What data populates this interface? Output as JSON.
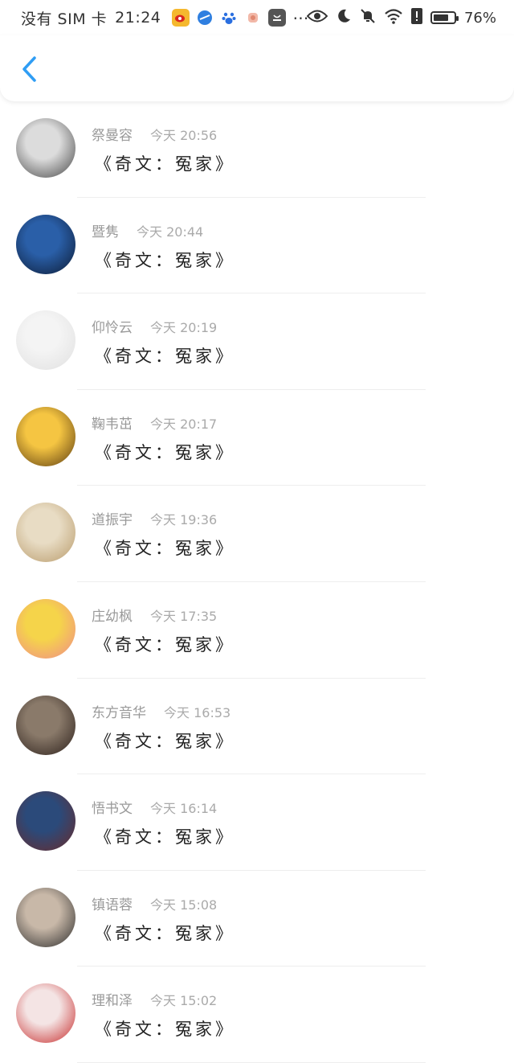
{
  "status_bar": {
    "carrier": "没有 SIM 卡",
    "time": "21:24",
    "battery_percent": "76%",
    "battery_level": 0.76,
    "app_icons": [
      "weibo-icon",
      "browser-icon",
      "baidu-icon",
      "app-icon",
      "huawei-store-icon",
      "more-dots-icon"
    ],
    "indicator_icons": [
      "eye-icon",
      "moon-icon",
      "mute-bell-icon",
      "wifi-icon",
      "alert-icon",
      "battery-icon"
    ]
  },
  "nav": {
    "back_icon": "chevron-left-icon",
    "accent_color": "#2f9df4"
  },
  "items": [
    {
      "name": "祭曼容",
      "time": "今天 20:56",
      "message": "《奇文：冤家》",
      "avatar_colors": [
        "#dcdcdc",
        "#444444"
      ]
    },
    {
      "name": "暨隽",
      "time": "今天 20:44",
      "message": "《奇文：冤家》",
      "avatar_colors": [
        "#2a5fa8",
        "#0c1a33"
      ]
    },
    {
      "name": "仰怜云",
      "time": "今天 20:19",
      "message": "《奇文：冤家》",
      "avatar_colors": [
        "#f4f4f4",
        "#e0e0e0"
      ]
    },
    {
      "name": "鞠韦茁",
      "time": "今天 20:17",
      "message": "《奇文：冤家》",
      "avatar_colors": [
        "#f5c542",
        "#5a3a10"
      ]
    },
    {
      "name": "道振宇",
      "time": "今天 19:36",
      "message": "《奇文：冤家》",
      "avatar_colors": [
        "#e8dcc4",
        "#b89a6a"
      ]
    },
    {
      "name": "庄幼枫",
      "time": "今天 17:35",
      "message": "《奇文：冤家》",
      "avatar_colors": [
        "#f5d44a",
        "#f08b8b"
      ]
    },
    {
      "name": "东方音华",
      "time": "今天 16:53",
      "message": "《奇文：冤家》",
      "avatar_colors": [
        "#8a7a6a",
        "#2b1f1a"
      ]
    },
    {
      "name": "悟书文",
      "time": "今天 16:14",
      "message": "《奇文：冤家》",
      "avatar_colors": [
        "#2b4a7a",
        "#6a2a2a"
      ]
    },
    {
      "name": "镇语蓉",
      "time": "今天 15:08",
      "message": "《奇文：冤家》",
      "avatar_colors": [
        "#c8b8a8",
        "#2a2a2a"
      ]
    },
    {
      "name": "理和泽",
      "time": "今天 15:02",
      "message": "《奇文：冤家》",
      "avatar_colors": [
        "#f4e4e4",
        "#c62828"
      ]
    }
  ]
}
